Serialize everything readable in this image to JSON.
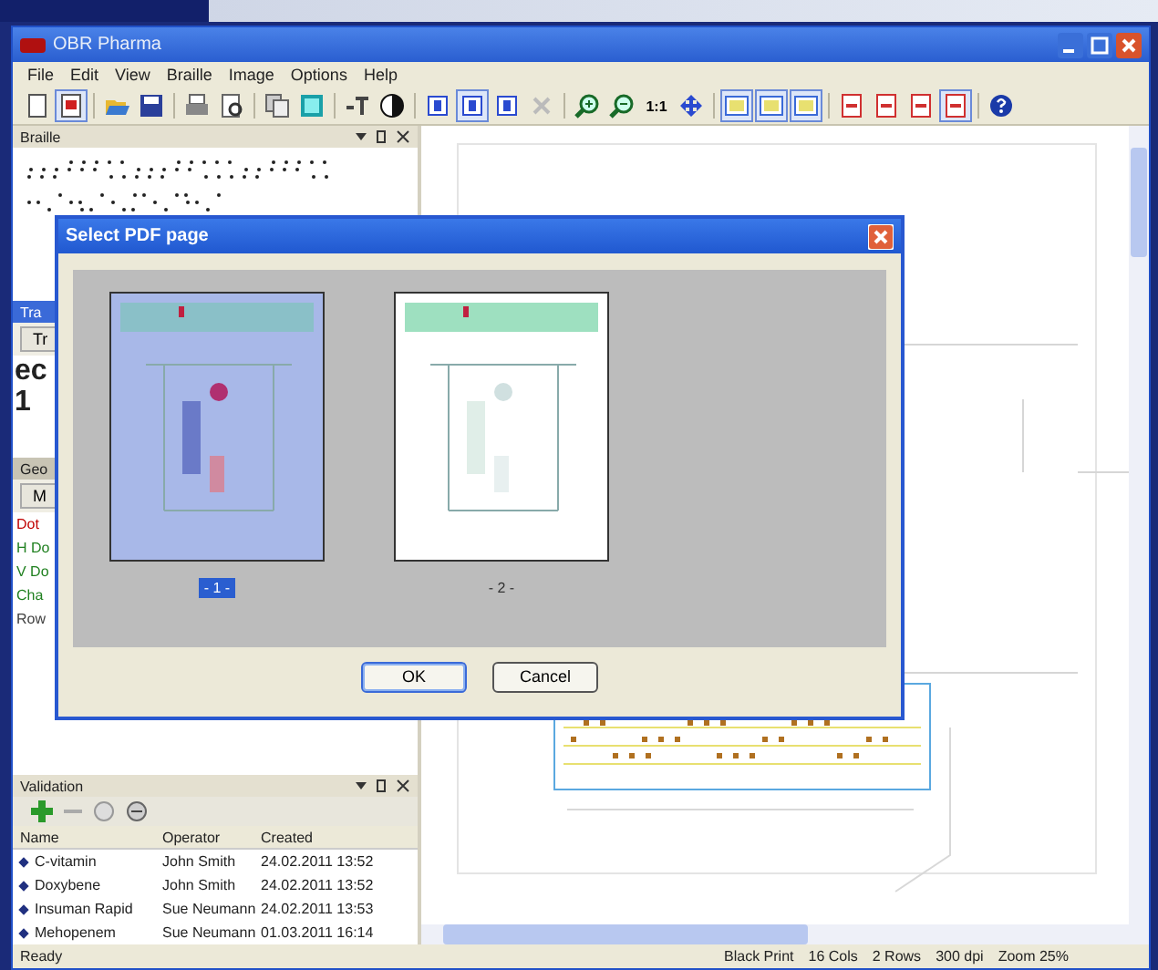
{
  "window": {
    "title": "OBR Pharma"
  },
  "menu": [
    "File",
    "Edit",
    "View",
    "Braille",
    "Image",
    "Options",
    "Help"
  ],
  "toolbar": [
    {
      "kind": "page",
      "pressed": false
    },
    {
      "kind": "pdf",
      "pressed": true
    },
    {
      "kind": "sep"
    },
    {
      "kind": "open",
      "pressed": false
    },
    {
      "kind": "save",
      "pressed": false
    },
    {
      "kind": "sep"
    },
    {
      "kind": "print",
      "pressed": false
    },
    {
      "kind": "preview",
      "pressed": false
    },
    {
      "kind": "sep"
    },
    {
      "kind": "copy",
      "pressed": false
    },
    {
      "kind": "image",
      "pressed": false
    },
    {
      "kind": "sep"
    },
    {
      "kind": "textsize",
      "pressed": false
    },
    {
      "kind": "contrast",
      "pressed": false
    },
    {
      "kind": "sep"
    },
    {
      "kind": "braille",
      "pressed": false
    },
    {
      "kind": "braille",
      "pressed": true
    },
    {
      "kind": "braille",
      "pressed": false
    },
    {
      "kind": "delete",
      "pressed": false
    },
    {
      "kind": "sep"
    },
    {
      "kind": "zoomin",
      "pressed": false
    },
    {
      "kind": "zoomout",
      "pressed": false
    },
    {
      "kind": "label",
      "label": "1:1",
      "pressed": false
    },
    {
      "kind": "move",
      "pressed": false
    },
    {
      "kind": "sep"
    },
    {
      "kind": "view",
      "pressed": true
    },
    {
      "kind": "view",
      "pressed": true
    },
    {
      "kind": "view",
      "pressed": true
    },
    {
      "kind": "sep"
    },
    {
      "kind": "red",
      "pressed": false
    },
    {
      "kind": "red",
      "pressed": false
    },
    {
      "kind": "red",
      "pressed": false
    },
    {
      "kind": "red",
      "pressed": true
    },
    {
      "kind": "sep"
    },
    {
      "kind": "help",
      "pressed": false
    }
  ],
  "braille_panel": {
    "title": "Braille"
  },
  "translation_panel": {
    "title": "Tra",
    "button": "Tr",
    "lines": [
      "ec",
      "1"
    ]
  },
  "geometry_panel": {
    "title": "Geo",
    "button": "M",
    "items": [
      {
        "label": "Dot",
        "color": "#c00000"
      },
      {
        "label": "H Do",
        "color": "#208020"
      },
      {
        "label": "V Do",
        "color": "#208020"
      },
      {
        "label": "Cha",
        "color": "#208020"
      },
      {
        "label": "Row",
        "color": "#404040"
      }
    ]
  },
  "validation": {
    "title": "Validation",
    "columns": [
      "Name",
      "Operator",
      "Created"
    ],
    "rows": [
      {
        "name": "C-vitamin",
        "operator": "John Smith",
        "created": "24.02.2011 13:52"
      },
      {
        "name": "Doxybene",
        "operator": "John Smith",
        "created": "24.02.2011 13:52"
      },
      {
        "name": "Insuman Rapid",
        "operator": "Sue Neumann",
        "created": "24.02.2011 13:53"
      },
      {
        "name": "Mehopenem",
        "operator": "Sue Neumann",
        "created": "01.03.2011 16:14"
      }
    ]
  },
  "dialog": {
    "title": "Select PDF page",
    "pages": [
      {
        "label": "- 1 -",
        "selected": true
      },
      {
        "label": "- 2 -",
        "selected": false
      }
    ],
    "buttons": [
      "OK",
      "Cancel"
    ]
  },
  "status_bar": {
    "left": "Ready",
    "items": [
      "Black Print",
      "16 Cols",
      "2 Rows",
      "300 dpi",
      "Zoom 25%"
    ]
  }
}
